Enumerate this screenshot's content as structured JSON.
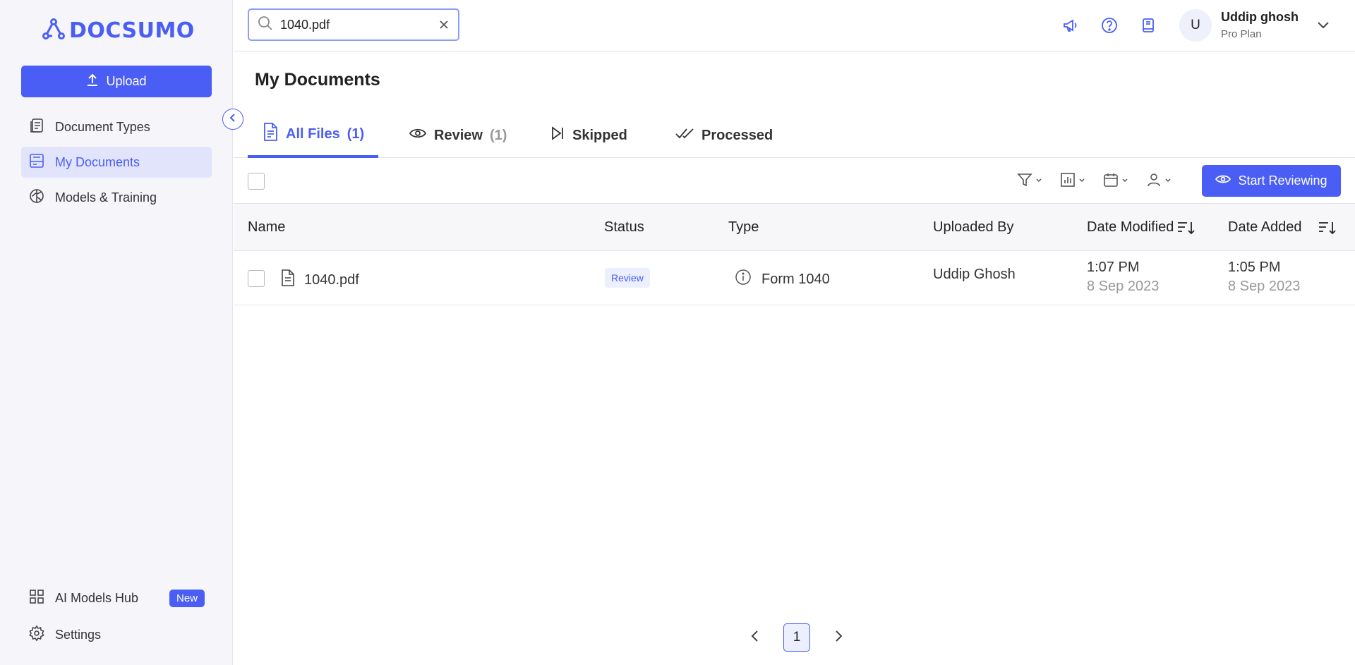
{
  "app": {
    "logo_text": "DOCSUMO"
  },
  "sidebar": {
    "upload_label": "Upload",
    "items": [
      {
        "label": "Document Types",
        "icon": "document-types-icon"
      },
      {
        "label": "My Documents",
        "icon": "my-documents-icon",
        "active": true
      },
      {
        "label": "Models & Training",
        "icon": "brain-icon"
      }
    ],
    "bottom_items": [
      {
        "label": "AI Models Hub",
        "icon": "grid-icon",
        "badge": "New"
      },
      {
        "label": "Settings",
        "icon": "gear-icon"
      }
    ]
  },
  "header": {
    "search_value": "1040.pdf",
    "user": {
      "initial": "U",
      "name": "Uddip ghosh",
      "plan": "Pro Plan"
    }
  },
  "page": {
    "title": "My Documents"
  },
  "tabs": [
    {
      "label": "All Files",
      "count": "(1)",
      "active": true
    },
    {
      "label": "Review",
      "count": "(1)"
    },
    {
      "label": "Skipped",
      "count": ""
    },
    {
      "label": "Processed",
      "count": ""
    }
  ],
  "toolbar": {
    "start_reviewing_label": "Start Reviewing"
  },
  "table": {
    "columns": [
      "Name",
      "Status",
      "Type",
      "Uploaded By",
      "Date Modified",
      "Date Added"
    ],
    "rows": [
      {
        "name": "1040.pdf",
        "status": "Review",
        "type": "Form 1040",
        "uploaded_by": "Uddip Ghosh",
        "date_modified": {
          "time": "1:07 PM",
          "date": "8 Sep 2023"
        },
        "date_added": {
          "time": "1:05 PM",
          "date": "8 Sep 2023"
        }
      }
    ]
  },
  "pagination": {
    "current_page": "1"
  },
  "colors": {
    "accent": "#4a5ef5",
    "accent_light": "#e2e4fb",
    "sidebar_bg": "#f6f6fa"
  }
}
